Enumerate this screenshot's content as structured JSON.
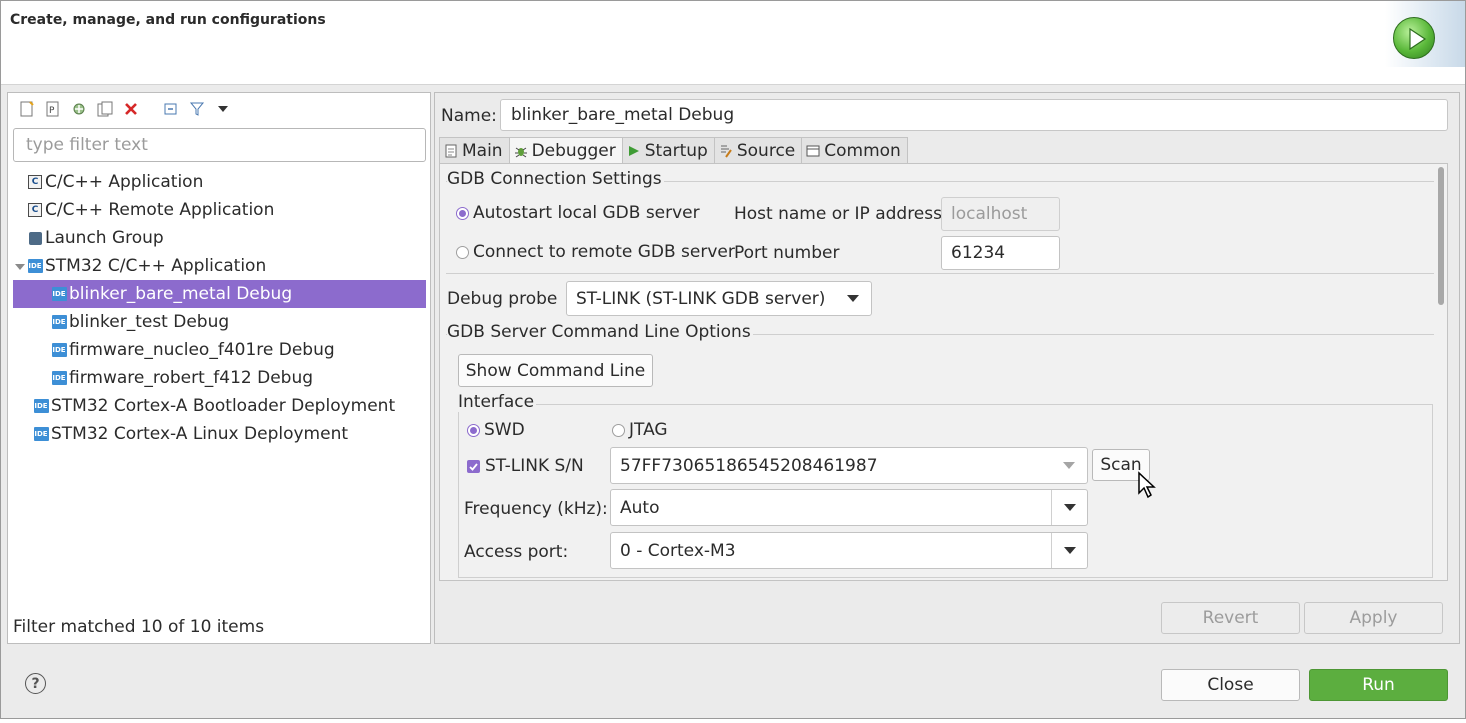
{
  "header": {
    "title": "Create, manage, and run configurations",
    "run_icon": "run-circle-icon"
  },
  "left": {
    "toolbar": [
      "new-config-icon",
      "new-prototype-icon",
      "export-icon",
      "duplicate-icon",
      "delete-icon",
      "collapse-all-icon",
      "filter-icon",
      "view-menu-icon"
    ],
    "filter_placeholder": "type filter text",
    "tree": [
      {
        "label": "C/C++ Application",
        "icon": "cpp-app-icon"
      },
      {
        "label": "C/C++ Remote Application",
        "icon": "cpp-app-icon"
      },
      {
        "label": "Launch Group",
        "icon": "launch-group-icon"
      },
      {
        "label": "STM32 C/C++ Application",
        "icon": "ide-icon",
        "expanded": true
      },
      {
        "label": "blinker_bare_metal Debug",
        "icon": "ide-icon",
        "selected": true
      },
      {
        "label": "blinker_test Debug",
        "icon": "ide-icon"
      },
      {
        "label": "firmware_nucleo_f401re Debug",
        "icon": "ide-icon"
      },
      {
        "label": "firmware_robert_f412 Debug",
        "icon": "ide-icon"
      },
      {
        "label": "STM32 Cortex-A Bootloader Deployment",
        "icon": "ide-icon"
      },
      {
        "label": "STM32 Cortex-A Linux Deployment",
        "icon": "ide-icon"
      }
    ],
    "ide_badge": "IDE",
    "cpp_badge": "C",
    "status": "Filter matched 10 of 10 items"
  },
  "right": {
    "name_label": "Name:",
    "name_value": "blinker_bare_metal Debug",
    "tabs": [
      {
        "label": "Main",
        "icon": "main-tab-icon"
      },
      {
        "label": "Debugger",
        "icon": "debugger-bug-icon",
        "active": true
      },
      {
        "label": "Startup",
        "icon": "startup-play-icon"
      },
      {
        "label": "Source",
        "icon": "source-icon"
      },
      {
        "label": "Common",
        "icon": "common-icon"
      }
    ],
    "gdb_conn": {
      "title": "GDB Connection Settings",
      "autostart_label": "Autostart local GDB server",
      "remote_label": "Connect to remote GDB server",
      "host_label": "Host name or IP address",
      "host_value": "localhost",
      "port_label": "Port number",
      "port_value": "61234"
    },
    "debug_probe": {
      "label": "Debug probe",
      "value": "ST-LINK (ST-LINK GDB server)"
    },
    "gdb_opts": {
      "title": "GDB Server Command Line Options",
      "show_cmd_button": "Show Command Line"
    },
    "interface": {
      "title": "Interface",
      "swd": "SWD",
      "jtag": "JTAG",
      "stlink_label": "ST-LINK S/N",
      "stlink_value": "57FF7306518654520846198​7",
      "scan_button": "Scan",
      "freq_label": "Frequency (kHz):",
      "freq_value": "Auto",
      "access_label": "Access port:",
      "access_value": "0 - Cortex-M3"
    },
    "revert_button": "Revert",
    "apply_button": "Apply"
  },
  "footer": {
    "close_button": "Close",
    "run_button": "Run",
    "help_glyph": "?"
  },
  "colors": {
    "selection": "#8c6bcd",
    "run_button": "#5cae3f"
  }
}
